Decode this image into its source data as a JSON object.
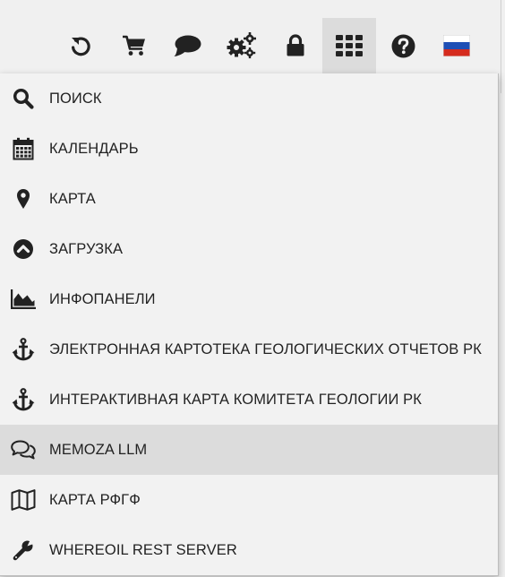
{
  "toolbar": {
    "buttons": [
      {
        "icon": "refresh-icon"
      },
      {
        "icon": "cart-icon"
      },
      {
        "icon": "chat-icon"
      },
      {
        "icon": "settings-icon"
      },
      {
        "icon": "lock-icon"
      },
      {
        "icon": "apps-grid-icon",
        "active": true
      },
      {
        "icon": "help-icon"
      },
      {
        "icon": "russian-flag-icon"
      }
    ]
  },
  "menu": {
    "items": [
      {
        "label": "ПОИСК",
        "icon": "search-icon"
      },
      {
        "label": "КАЛЕНДАРЬ",
        "icon": "calendar-icon"
      },
      {
        "label": "КАРТА",
        "icon": "map-marker-icon"
      },
      {
        "label": "ЗАГРУЗКА",
        "icon": "upload-icon"
      },
      {
        "label": "ИНФОПАНЕЛИ",
        "icon": "area-chart-icon"
      },
      {
        "label": "ЭЛЕКТРОННАЯ КАРТОТЕКА ГЕОЛОГИЧЕСКИХ ОТЧЕТОВ РК",
        "icon": "anchor-icon"
      },
      {
        "label": "ИНТЕРАКТИВНАЯ КАРТА КОМИТЕТА ГЕОЛОГИИ РК",
        "icon": "anchor-icon"
      },
      {
        "label": "MEMOZA LLM",
        "icon": "comments-icon",
        "highlighted": true
      },
      {
        "label": "КАРТА РФГФ",
        "icon": "folded-map-icon"
      },
      {
        "label": "WHEREOIL REST SERVER",
        "icon": "wrench-icon"
      }
    ]
  },
  "colors": {
    "page_background": "#f0f0f0",
    "menu_background": "#f2f2f2",
    "highlight_background": "#dcdcdc",
    "icon_color": "#222222",
    "flag_white": "#ffffff",
    "flag_blue": "#1e4fb5",
    "flag_red": "#d52b1e"
  }
}
